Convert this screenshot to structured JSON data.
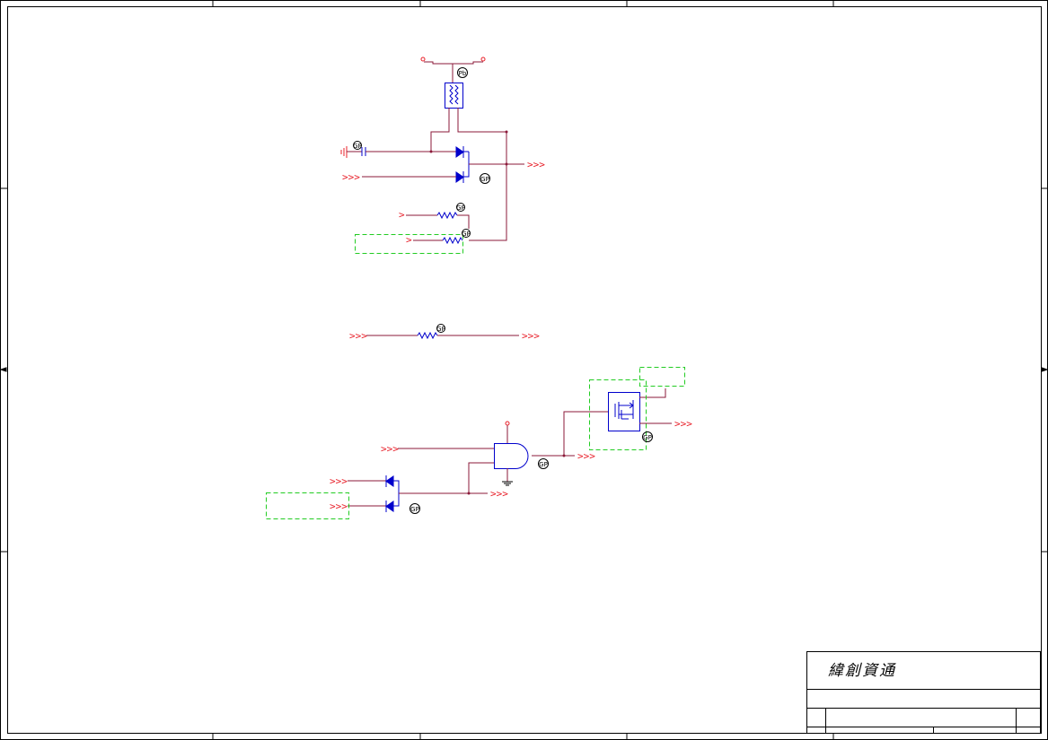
{
  "title_block": {
    "company": "緯創資通"
  },
  "colors": {
    "wire": "#8b1a3a",
    "component": "#0000cc",
    "port": "#e8202a",
    "border": "#000000",
    "no_stuff_box": "#22cc22"
  },
  "symbols": {
    "reference_tags": [
      "Pb",
      "GP",
      "GP",
      "GP",
      "GP",
      "GP",
      "GP",
      "GP",
      "GP",
      "GP"
    ]
  }
}
